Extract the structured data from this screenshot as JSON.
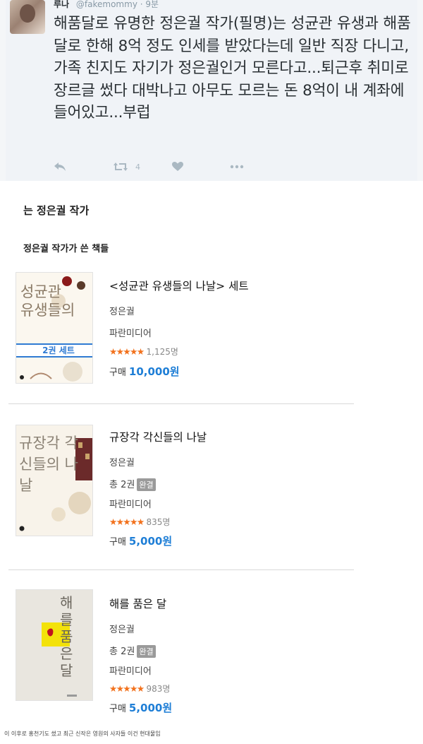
{
  "tweet": {
    "name": "루나",
    "handle": "@fakemommy",
    "time": "· 9분",
    "text": "해품달로 유명한 정은궐 작가(필명)는 성균관 유생과 해품달로 한해 8억 정도 인세를 받았다는데 일반 직장 다니고, 가족 친지도 자기가 정은궐인거 모른다고...퇴근후 취미로 장르글 썼다 대박나고 아무도 모르는 돈 8억이 내 계좌에 들어있고...부럽",
    "retweet_count": "4"
  },
  "author": {
    "title": "는 정은궐 작가",
    "books_heading": "정은궐 작가가 쓴 책들"
  },
  "books": [
    {
      "title": "<성균관 유생들의 나날> 세트",
      "author": "정은궐",
      "publisher": "파란미디어",
      "rating_count": "1,125명",
      "price_label": "구매",
      "price": "10,000원",
      "cover_band": "2권 세트",
      "cover_title": "성균관 유생들의"
    },
    {
      "title": "규장각 각신들의 나날",
      "author": "정은궐",
      "volumes": "총 2권",
      "status_badge": "완결",
      "publisher": "파란미디어",
      "rating_count": "835명",
      "price_label": "구매",
      "price": "5,000원",
      "cover_title": "규장각 각신들의 나날"
    },
    {
      "title": "해를 품은 달",
      "author": "정은궐",
      "volumes": "총 2권",
      "status_badge": "완결",
      "publisher": "파란미디어",
      "rating_count": "983명",
      "price_label": "구매",
      "price": "5,000원",
      "cover_title": "해를 품은 달"
    }
  ],
  "footnote": "이 이후로 홍천기도 썼고 최근 신작은 영원의 사자들 이건 현대물임",
  "colors": {
    "price_blue": "#1e7ed6",
    "star_orange": "#f2711c",
    "tweet_bg": "#f0f3f7"
  }
}
